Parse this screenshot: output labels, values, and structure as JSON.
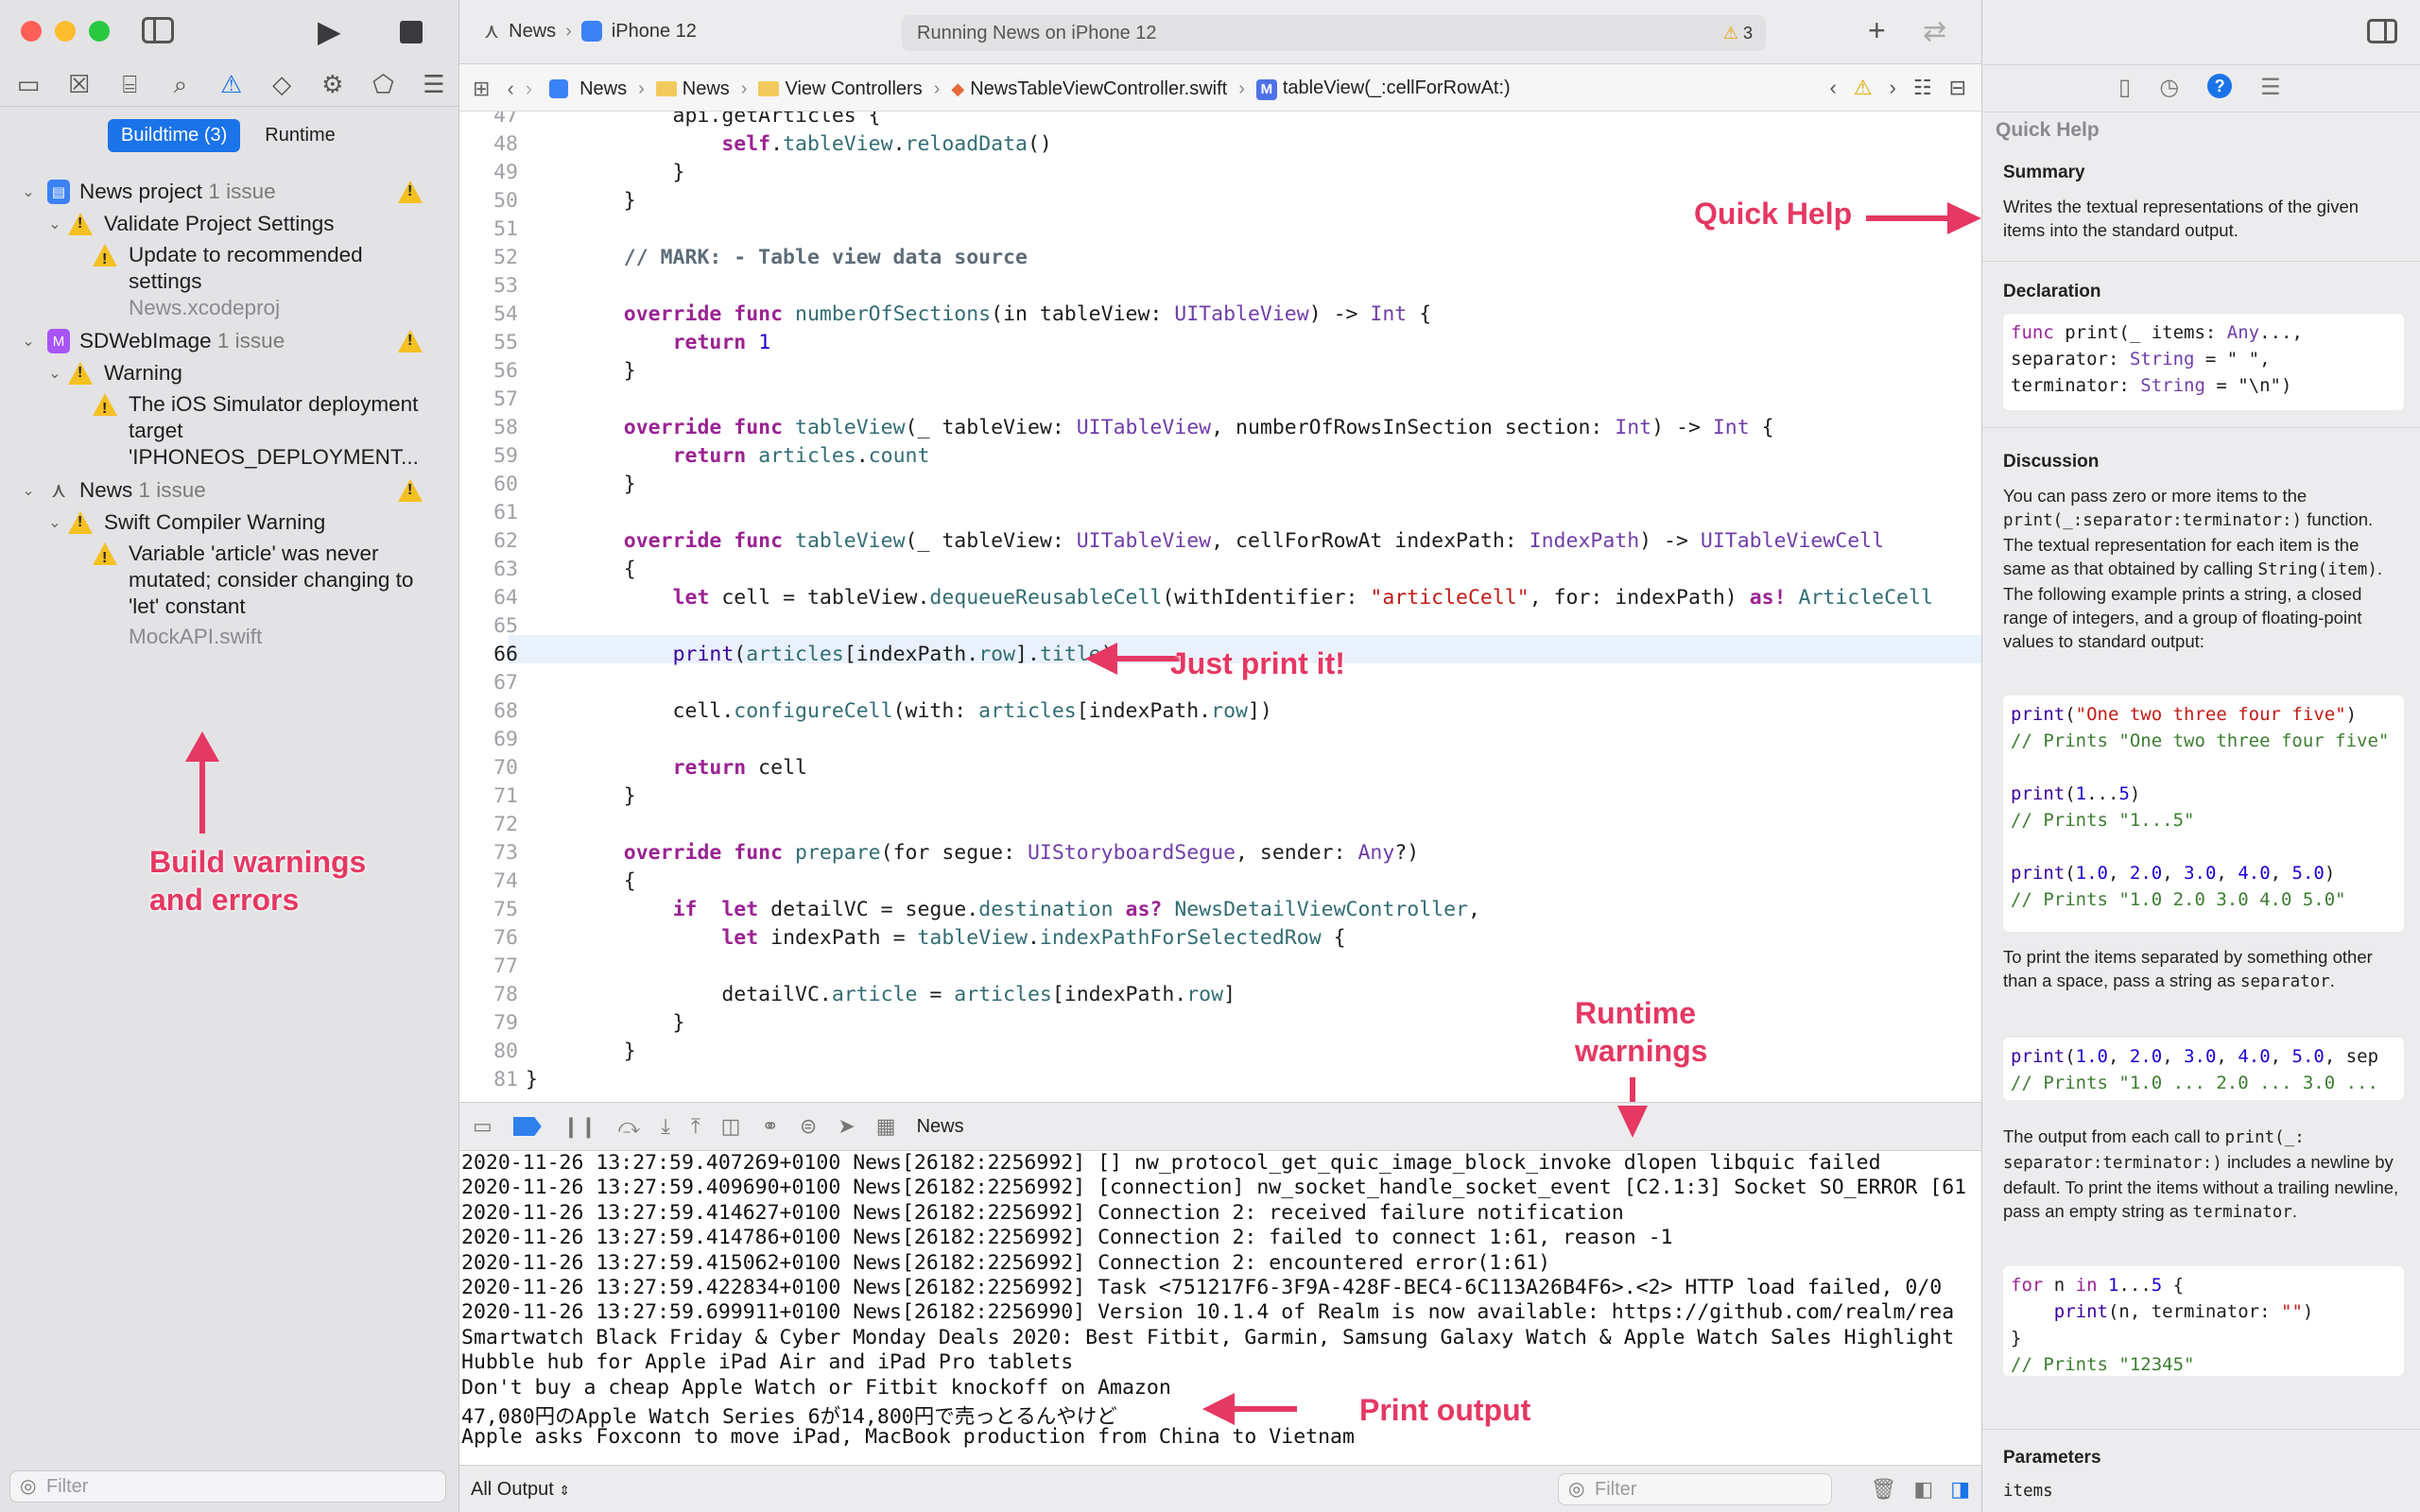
{
  "colors": {
    "accent": "#1a73e8",
    "annotation": "#e53863",
    "warning": "#f5c021"
  },
  "window": {
    "scheme_project": "News",
    "scheme_device": "iPhone 12",
    "status_text": "Running News on iPhone 12",
    "status_warnings": "3"
  },
  "navigator": {
    "scope_tabs": [
      "Buildtime (3)",
      "Runtime"
    ],
    "filter_placeholder": "Filter",
    "groups": [
      {
        "title": "News project",
        "count": "1 issue",
        "sub_title": "Validate Project Settings",
        "issue": "Update to recommended settings",
        "file": "News.xcodeproj"
      },
      {
        "title": "SDWebImage",
        "count": "1 issue",
        "sub_title": "Warning",
        "issue": "The iOS Simulator deployment target 'IPHONEOS_DEPLOYMENT..."
      },
      {
        "title": "News",
        "count": "1 issue",
        "sub_title": "Swift Compiler Warning",
        "issue": "Variable 'article' was never mutated; consider changing to 'let' constant",
        "file": "MockAPI.swift"
      }
    ]
  },
  "jump_bar": {
    "path": [
      "News",
      "News",
      "View Controllers",
      "NewsTableViewController.swift",
      "tableView(_:cellForRowAt:)"
    ]
  },
  "editor": {
    "current_line": 66
  },
  "debug_bar": {
    "target": "News"
  },
  "console": {
    "lines": [
      "2020-11-26 13:27:59.407269+0100 News[26182:2256992] [] nw_protocol_get_quic_image_block_invoke dlopen libquic failed",
      "2020-11-26 13:27:59.409690+0100 News[26182:2256992] [connection] nw_socket_handle_socket_event [C2.1:3] Socket SO_ERROR [61",
      "2020-11-26 13:27:59.414627+0100 News[26182:2256992] Connection 2: received failure notification",
      "2020-11-26 13:27:59.414786+0100 News[26182:2256992] Connection 2: failed to connect 1:61, reason -1",
      "2020-11-26 13:27:59.415062+0100 News[26182:2256992] Connection 2: encountered error(1:61)",
      "2020-11-26 13:27:59.422834+0100 News[26182:2256992] Task <751217F6-3F9A-428F-BEC4-6C113A26B4F6>.<2> HTTP load failed, 0/0",
      "2020-11-26 13:27:59.699911+0100 News[26182:2256990] Version 10.1.4 of Realm is now available: https://github.com/realm/rea",
      "Smartwatch Black Friday & Cyber Monday Deals 2020: Best Fitbit, Garmin, Samsung Galaxy Watch & Apple Watch Sales Highlight",
      "Hubble hub for Apple iPad Air and iPad Pro tablets",
      "Don't buy a cheap Apple Watch or Fitbit knockoff on Amazon",
      "47,080円のApple Watch Series 6が14,800円で売っとるんやけど",
      "Apple asks Foxconn to move iPad, MacBook production from China to Vietnam"
    ],
    "output_selector": "All Output",
    "filter_placeholder": "Filter"
  },
  "inspector": {
    "title": "Quick Help",
    "summary_heading": "Summary",
    "summary_text": "Writes the textual representations of the given items into the standard output.",
    "declaration_heading": "Declaration",
    "discussion_heading": "Discussion",
    "discussion_p1_a": "You can pass zero or more items to the",
    "discussion_p1_code": "print(_:separator:terminator:)",
    "discussion_p1_b": "function. The textual representation for each item is the same as that obtained by calling",
    "discussion_p1_code2": "String(item)",
    "discussion_p1_c": ". The following example prints a string, a closed range of integers, and a group of floating-point values to standard output:",
    "discussion_p2": "To print the items separated by something other than a space, pass a string as",
    "discussion_p2_code": "separator",
    "discussion_p3_a": "The output from each call to",
    "discussion_p3_code": "print(_: separator:terminator:)",
    "discussion_p3_b": "includes a newline by default. To print the items without a trailing newline, pass an empty string as",
    "discussion_p3_code2": "terminator",
    "parameters_heading": "Parameters",
    "parameters_first": "items"
  },
  "annotations": {
    "quick_help": "Quick Help",
    "just_print": "Just print it!",
    "build_warnings_1": "Build warnings",
    "build_warnings_2": "and errors",
    "runtime_1": "Runtime",
    "runtime_2": "warnings",
    "print_output": "Print output"
  }
}
